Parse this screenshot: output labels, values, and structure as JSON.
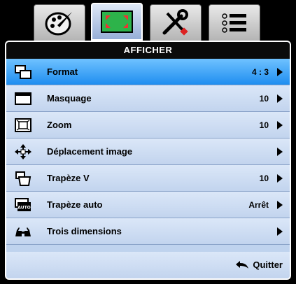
{
  "tabs": [
    {
      "icon": "palette-icon"
    },
    {
      "icon": "display-icon",
      "active": true
    },
    {
      "icon": "tools-icon"
    },
    {
      "icon": "list-icon"
    }
  ],
  "panel": {
    "title": "AFFICHER",
    "rows": [
      {
        "label": "Format",
        "value": "4 : 3",
        "icon": "format-icon",
        "selected": true
      },
      {
        "label": "Masquage",
        "value": "10",
        "icon": "mask-icon"
      },
      {
        "label": "Zoom",
        "value": "10",
        "icon": "zoom-icon"
      },
      {
        "label": "Déplacement image",
        "value": "",
        "icon": "move-icon"
      },
      {
        "label": "Trapèze V",
        "value": "10",
        "icon": "keystone-icon"
      },
      {
        "label": "Trapèze auto",
        "value": "Arrêt",
        "icon": "auto-keystone-icon",
        "icon_text": "AUTO"
      },
      {
        "label": "Trois dimensions",
        "value": "",
        "icon": "3d-glasses-icon"
      }
    ],
    "quit_label": "Quitter"
  },
  "colors": {
    "panel_bg": "#bfd3ee",
    "selected": "#1f8ef0",
    "title_bg": "#0b0b0b"
  }
}
